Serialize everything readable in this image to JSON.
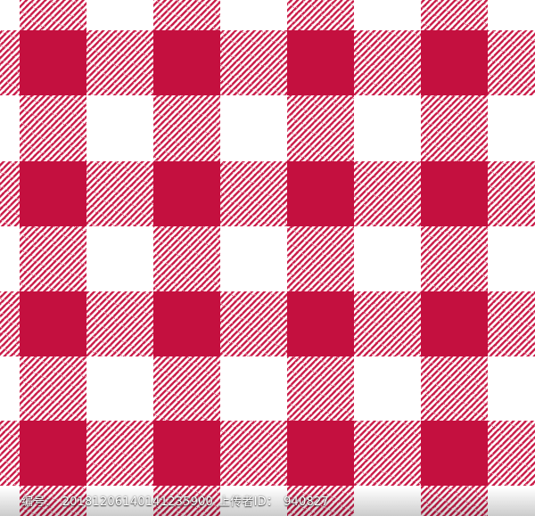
{
  "pattern": {
    "name": "gingham-check",
    "colors": {
      "solid": "#c4103f",
      "hatch": "#c91a47",
      "background": "#ffffff"
    }
  },
  "footer": {
    "id_label": "编号：",
    "id_value": "20181206140141235900",
    "uploader_label": "上传者ID：",
    "uploader_value": "940827"
  }
}
